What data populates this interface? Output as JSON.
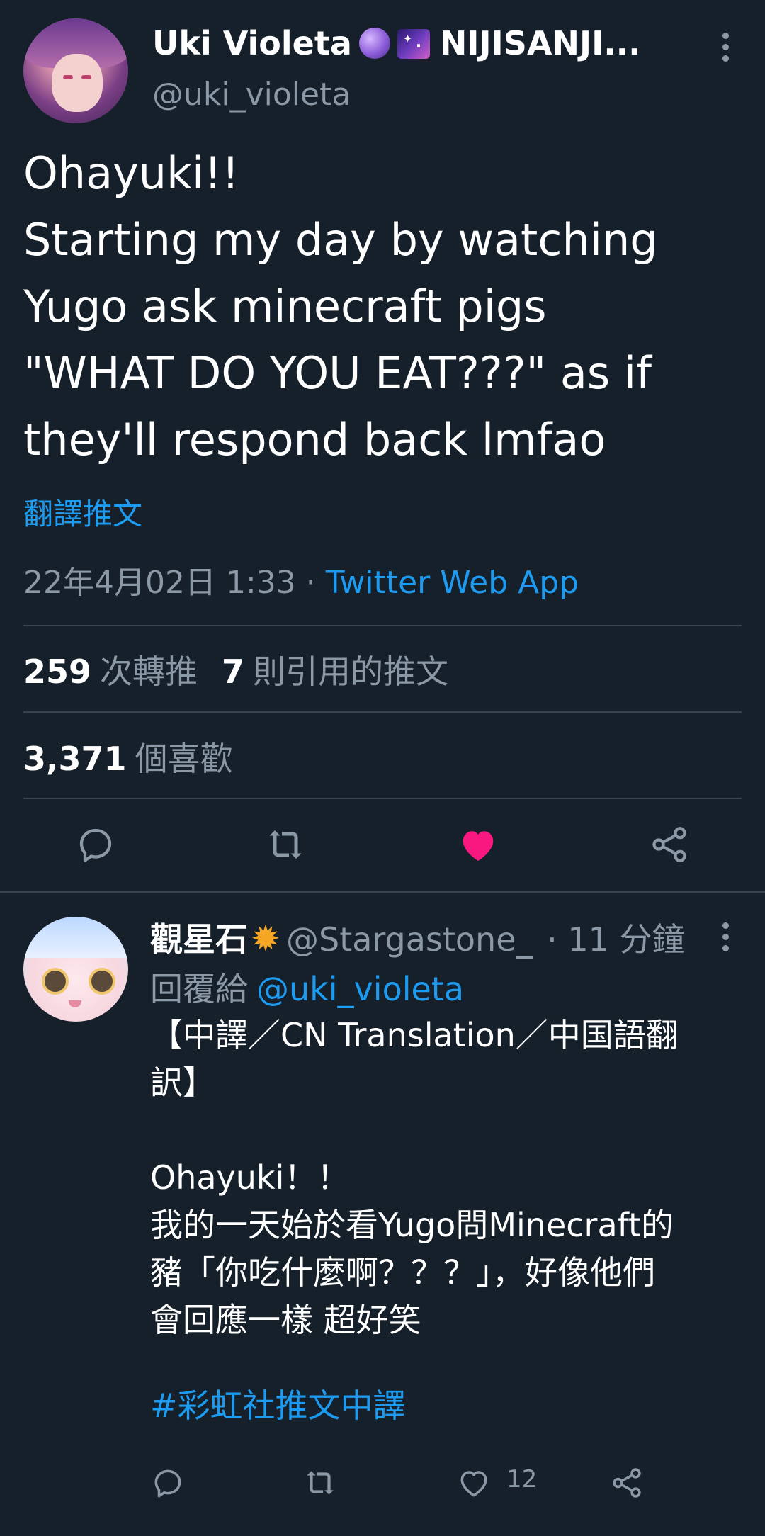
{
  "tweet": {
    "author_name": "Uki Violeta",
    "author_name_suffix": "NIJISANJI...",
    "author_handle": "@uki_violeta",
    "text": "Ohayuki!!\nStarting my day by watching\nYugo ask minecraft pigs\n\"WHAT DO YOU EAT???\" as if\nthey'll respond back lmfao",
    "translate_label": "翻譯推文",
    "timestamp": "22年4月02日 1:33",
    "separator": "·",
    "source_app": "Twitter Web App",
    "retweets_count": "259",
    "retweets_label": "次轉推",
    "quotes_count": "7",
    "quotes_label": "則引用的推文",
    "likes_count": "3,371",
    "likes_label": "個喜歡",
    "liked": true,
    "like_color": "#f91880"
  },
  "reply": {
    "author_name": "觀星石",
    "author_handle": "@Stargastone_",
    "time": "· 11 分鐘",
    "replying_to_label": "回覆給",
    "replying_to_handle": "@uki_violeta",
    "text": "【中譯／CN Translation／中国語翻\n訳】\n\nOhayuki！！\n我的一天始於看Yugo問Minecraft的\n豬「你吃什麼啊？？？」，好像他們\n會回應一樣 超好笑",
    "hashtag": "#彩虹社推文中譯",
    "like_count": "12"
  },
  "colors": {
    "background": "#15202b",
    "text_primary": "#ffffff",
    "text_secondary": "#8b98a5",
    "accent": "#1d9bf0",
    "divider": "#38444d"
  }
}
